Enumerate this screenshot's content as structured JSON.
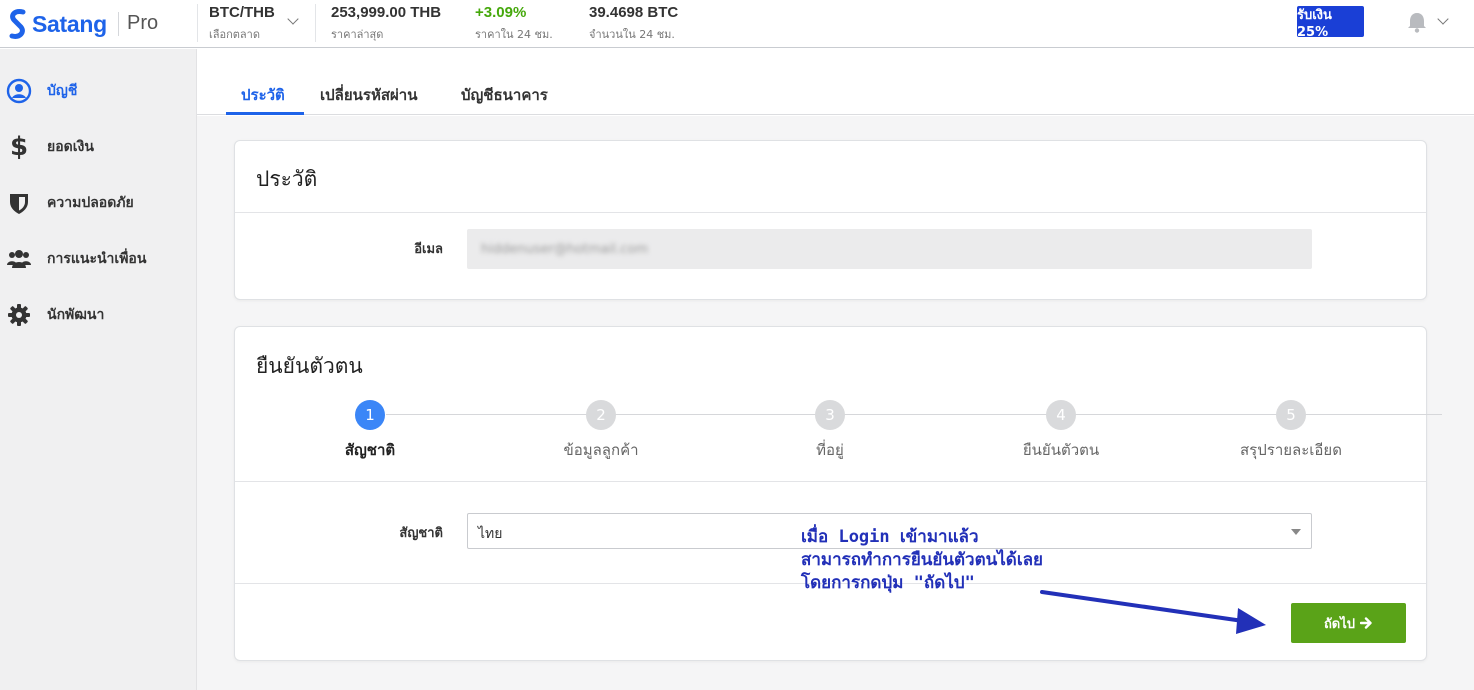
{
  "topbar": {
    "logo_text": "Satang",
    "logo_suffix": "Pro",
    "pair": "BTC/THB",
    "pair_sub": "เลือกตลาด",
    "last_price": "253,999.00 THB",
    "last_price_sub": "ราคาล่าสุด",
    "change": "+3.09%",
    "change_sub": "ราคาใน 24 ชม.",
    "volume": "39.4698 BTC",
    "volume_sub": "จำนวนใน 24 ชม.",
    "promo_label": "รับเงิน 25%",
    "colors": {
      "brand": "#1e63e9",
      "promo": "#1a3fd6",
      "positive": "#45a80b"
    },
    "icons": [
      "chevron-down-icon",
      "bell-icon"
    ]
  },
  "sidebar": {
    "items": [
      {
        "label": "บัญชี",
        "icon": "user-circle-icon",
        "active": true
      },
      {
        "label": "ยอดเงิน",
        "icon": "dollar-icon",
        "active": false
      },
      {
        "label": "ความปลอดภัย",
        "icon": "shield-icon",
        "active": false
      },
      {
        "label": "การแนะนำเพื่อน",
        "icon": "users-icon",
        "active": false
      },
      {
        "label": "นักพัฒนา",
        "icon": "gear-icon",
        "active": false
      }
    ]
  },
  "tabs": [
    {
      "label": "ประวัติ",
      "active": true
    },
    {
      "label": "เปลี่ยนรหัสผ่าน",
      "active": false
    },
    {
      "label": "บัญชีธนาคาร",
      "active": false
    }
  ],
  "profile_card": {
    "title": "ประวัติ",
    "email_label": "อีเมล",
    "email_value": "hiddenuser@hotmail.com"
  },
  "verify_card": {
    "title": "ยืนยันตัวตน",
    "steps": [
      {
        "number": "1",
        "label": "สัญชาติ",
        "active": true
      },
      {
        "number": "2",
        "label": "ข้อมูลลูกค้า",
        "active": false
      },
      {
        "number": "3",
        "label": "ที่อยู่",
        "active": false
      },
      {
        "number": "4",
        "label": "ยืนยันตัวตน",
        "active": false
      },
      {
        "number": "5",
        "label": "สรุปรายละเอียด",
        "active": false
      }
    ],
    "nationality_label": "สัญชาติ",
    "nationality_value": "ไทย",
    "next_label": "ถัดไป",
    "next_color": "#5aa318"
  },
  "annotation": {
    "lines": [
      "เมื่อ Login เข้ามาแล้ว",
      "สามารถทำการยืนยันตัวตนได้เลย",
      "โดยการกดปุ่ม \"ถัดไป\""
    ],
    "color": "#2230b8"
  }
}
